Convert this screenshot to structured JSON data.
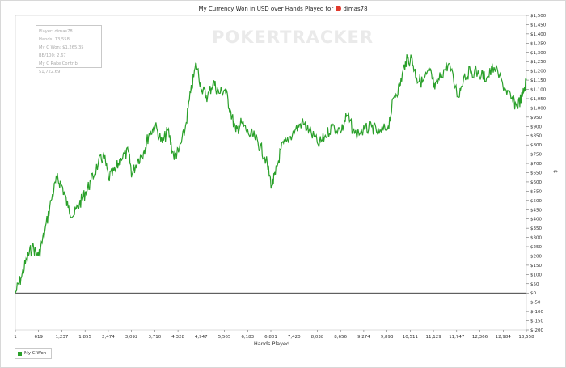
{
  "title": {
    "prefix": "My Currency Won in USD over Hands Played for",
    "player": "dimas78"
  },
  "watermark": "POKERTRACKER",
  "infobox": {
    "player": "Player: dimas78",
    "hands": "Hands: 13,558",
    "won": "My C Won: $1,265.35",
    "bb100": "BB/100: 2.67",
    "rake": "My C Rake Contrib: $1,722.69"
  },
  "legend": {
    "label": "My C Won",
    "icon": "green-square-icon"
  },
  "colors": {
    "series": "#2aa02a",
    "zero_line": "#000000",
    "grid": "#e6e6e6"
  },
  "chart_data": {
    "type": "line",
    "title": "My Currency Won in USD over Hands Played for dimas78",
    "xlabel": "Hands Played",
    "ylabel": "$",
    "xlim": [
      1,
      13558
    ],
    "ylim": [
      -200,
      1500
    ],
    "x_tick_labels": [
      "1",
      "619",
      "1,237",
      "1,855",
      "2,474",
      "3,092",
      "3,710",
      "4,328",
      "4,947",
      "5,565",
      "6,183",
      "6,801",
      "7,420",
      "8,038",
      "8,656",
      "9,274",
      "9,893",
      "10,511",
      "11,129",
      "11,747",
      "12,366",
      "12,984",
      "13,558"
    ],
    "y_tick_labels": [
      "$1,500",
      "$1,450",
      "$1,400",
      "$1,350",
      "$1,300",
      "$1,250",
      "$1,200",
      "$1,150",
      "$1,100",
      "$1,050",
      "$1,000",
      "$950",
      "$900",
      "$850",
      "$800",
      "$750",
      "$700",
      "$650",
      "$600",
      "$550",
      "$500",
      "$450",
      "$400",
      "$350",
      "$300",
      "$250",
      "$200",
      "$150",
      "$100",
      "$50",
      "$0",
      "$-50",
      "$-100",
      "$-150",
      "$-200"
    ],
    "y_tick_values": [
      1500,
      1450,
      1400,
      1350,
      1300,
      1250,
      1200,
      1150,
      1100,
      1050,
      1000,
      950,
      900,
      850,
      800,
      750,
      700,
      650,
      600,
      550,
      500,
      450,
      400,
      350,
      300,
      250,
      200,
      150,
      100,
      50,
      0,
      -50,
      -100,
      -150,
      -200
    ],
    "legend": "bottom-left",
    "grid": false,
    "series": [
      {
        "name": "My C Won",
        "x": [
          1,
          150,
          300,
          450,
          619,
          780,
          950,
          1100,
          1237,
          1400,
          1550,
          1700,
          1855,
          2000,
          2200,
          2350,
          2474,
          2650,
          2800,
          3000,
          3092,
          3250,
          3400,
          3550,
          3710,
          3900,
          4050,
          4200,
          4328,
          4500,
          4650,
          4800,
          4947,
          5100,
          5250,
          5400,
          5565,
          5700,
          5850,
          6000,
          6183,
          6350,
          6500,
          6650,
          6801,
          6900,
          7050,
          7200,
          7420,
          7600,
          7800,
          8038,
          8200,
          8400,
          8656,
          8800,
          9000,
          9274,
          9450,
          9650,
          9893,
          10050,
          10200,
          10350,
          10511,
          10650,
          10800,
          11000,
          11129,
          11300,
          11500,
          11747,
          11900,
          12100,
          12366,
          12500,
          12700,
          12984,
          13150,
          13300,
          13450,
          13558
        ],
        "y": [
          0,
          80,
          180,
          250,
          200,
          330,
          500,
          620,
          580,
          460,
          420,
          480,
          540,
          600,
          700,
          740,
          620,
          660,
          730,
          760,
          640,
          720,
          760,
          860,
          900,
          810,
          880,
          740,
          760,
          880,
          1080,
          1240,
          1100,
          1060,
          1140,
          1080,
          1100,
          990,
          870,
          920,
          860,
          840,
          790,
          720,
          580,
          640,
          780,
          820,
          880,
          920,
          880,
          800,
          840,
          900,
          880,
          960,
          860,
          880,
          900,
          860,
          900,
          1060,
          1120,
          1250,
          1270,
          1160,
          1140,
          1200,
          1100,
          1180,
          1240,
          1060,
          1170,
          1200,
          1180,
          1160,
          1220,
          1110,
          1050,
          1010,
          1060,
          1150
        ]
      }
    ]
  }
}
